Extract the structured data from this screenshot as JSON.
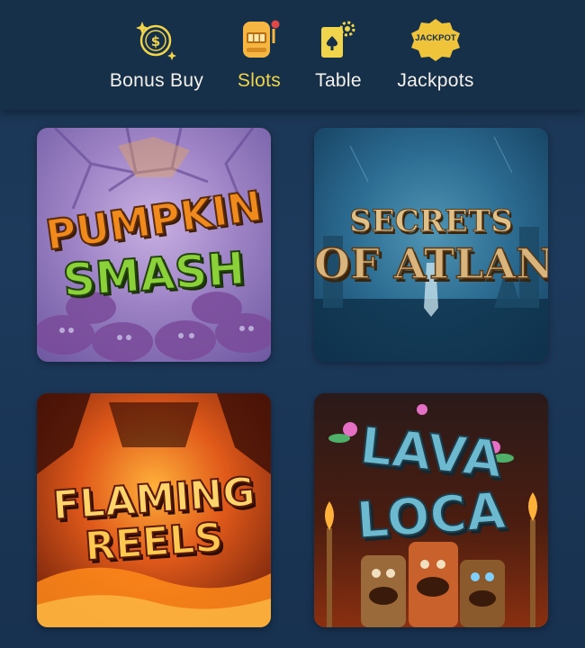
{
  "tabs": [
    {
      "label": "Bonus Buy",
      "icon": "coin-stars-icon",
      "active": false
    },
    {
      "label": "Slots",
      "icon": "slot-machine-icon",
      "active": true
    },
    {
      "label": "Table",
      "icon": "playing-cards-icon",
      "active": false
    },
    {
      "label": "Jackpots",
      "icon": "jackpot-badge-icon",
      "active": false
    }
  ],
  "jackpot_badge_text": "JACKPOT",
  "games": [
    {
      "title_line1": "PUMPKIN",
      "title_line2": "SMASH"
    },
    {
      "title_line1": "SECRETS",
      "title_line2": "OF ATLANTIS"
    },
    {
      "title_line1": "FLAMING",
      "title_line2": "REELS"
    },
    {
      "title_line1": "LAVA",
      "title_line2": "LOCA"
    }
  ],
  "colors": {
    "header_bg": "#16304a",
    "page_bg": "#1d3a5c",
    "accent_gold": "#f0d44b",
    "label_white": "#f4f1ea"
  }
}
